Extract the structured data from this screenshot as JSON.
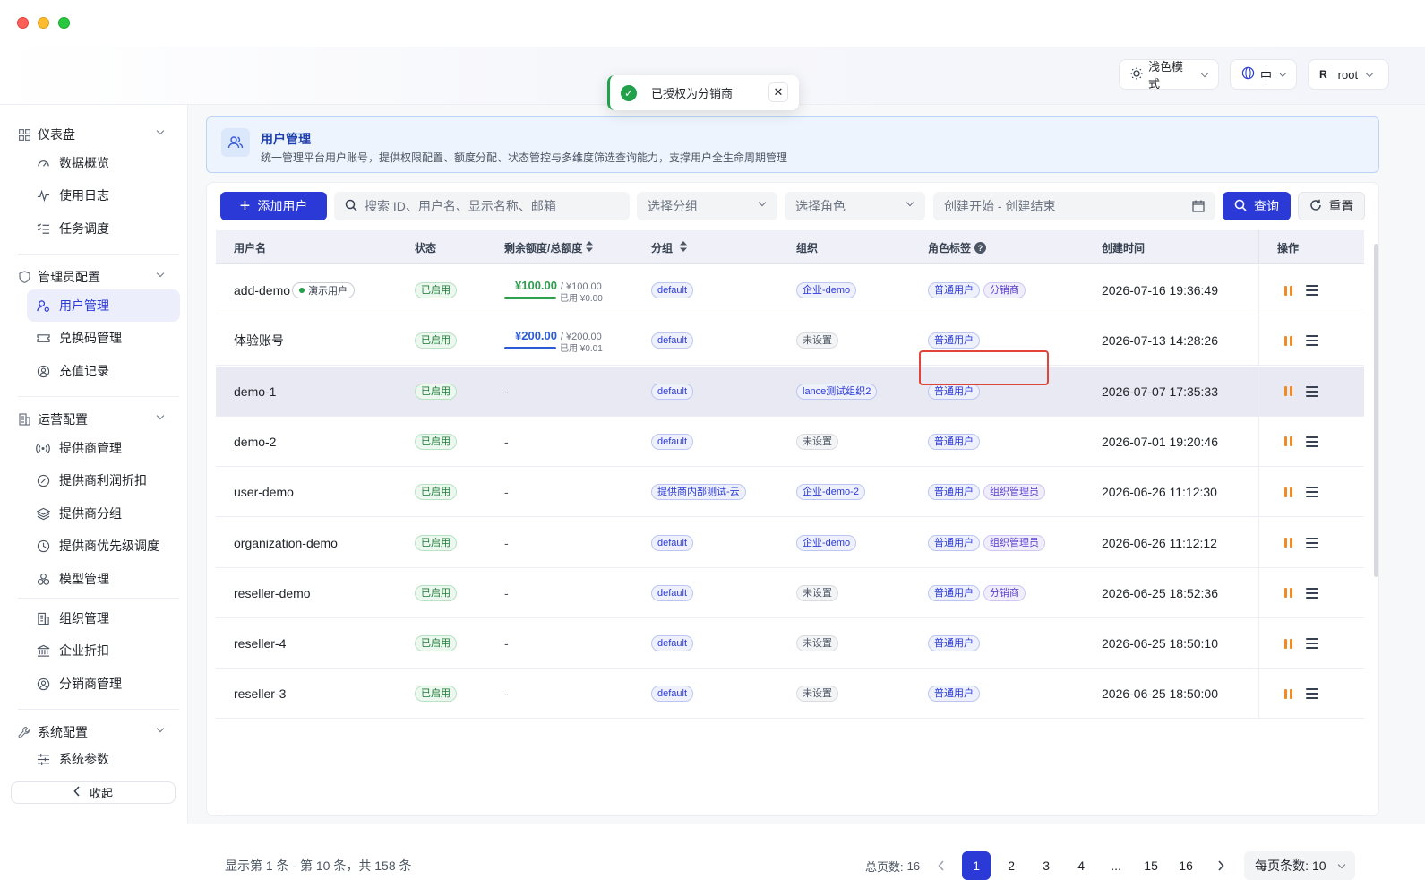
{
  "toast": {
    "text": "已授权为分销商"
  },
  "topbar": {
    "theme_label": "浅色模式",
    "lang_label": "中",
    "user_initial": "R",
    "user_name": "root"
  },
  "sidebar": {
    "sections": [
      {
        "label": "仪表盘",
        "items": [
          "数据概览",
          "使用日志",
          "任务调度"
        ]
      },
      {
        "label": "管理员配置",
        "items": [
          "用户管理",
          "兑换码管理",
          "充值记录"
        ]
      },
      {
        "label": "运营配置",
        "items": [
          "提供商管理",
          "提供商利润折扣",
          "提供商分组",
          "提供商优先级调度",
          "模型管理",
          "组织管理",
          "企业折扣",
          "分销商管理"
        ]
      },
      {
        "label": "系统配置",
        "items": [
          "系统参数"
        ]
      }
    ],
    "collapse_label": "收起"
  },
  "banner": {
    "title": "用户管理",
    "desc": "统一管理平台用户账号，提供权限配置、额度分配、状态管控与多维度筛选查询能力，支撑用户全生命周期管理"
  },
  "filters": {
    "add_label": "添加用户",
    "search_placeholder": "搜索 ID、用户名、显示名称、邮箱",
    "group_placeholder": "选择分组",
    "role_placeholder": "选择角色",
    "date_placeholder": "创建开始 - 创建结束",
    "query_label": "查询",
    "reset_label": "重置"
  },
  "table": {
    "columns": [
      "用户名",
      "状态",
      "剩余额度/总额度",
      "分组",
      "组织",
      "角色标签",
      "创建时间",
      "操作"
    ],
    "rows": [
      {
        "name": "add-demo",
        "badge": "演示用户",
        "status": "已启用",
        "quota": {
          "amount": "¥100.00",
          "total": "/ ¥100.00",
          "used": "已用 ¥0.00",
          "color": "#2e9e4f",
          "fill": 1.0
        },
        "group": "default",
        "org": "企业-demo",
        "org_set": true,
        "roles": [
          "普通用户",
          "分销商"
        ],
        "created": "2026-07-16 19:36:49"
      },
      {
        "name": "体验账号",
        "status": "已启用",
        "quota": {
          "amount": "¥200.00",
          "total": "/ ¥200.00",
          "used": "已用 ¥0.01",
          "color": "#2b5bd6",
          "fill": 1.0
        },
        "group": "default",
        "org": "未设置",
        "org_set": false,
        "roles": [
          "普通用户"
        ],
        "created": "2026-07-13 14:28:26"
      },
      {
        "name": "demo-1",
        "status": "已启用",
        "quota_text": "-",
        "group": "default",
        "org": "lance测试组织2",
        "org_set": true,
        "roles": [
          "普通用户"
        ],
        "created": "2026-07-07 17:35:33"
      },
      {
        "name": "demo-2",
        "status": "已启用",
        "quota_text": "-",
        "group": "default",
        "org": "未设置",
        "org_set": false,
        "roles": [
          "普通用户"
        ],
        "created": "2026-07-01 19:20:46"
      },
      {
        "name": "user-demo",
        "status": "已启用",
        "quota_text": "-",
        "group": "提供商内部测试-云",
        "org": "企业-demo-2",
        "org_set": true,
        "roles": [
          "普通用户",
          "组织管理员"
        ],
        "created": "2026-06-26 11:12:30"
      },
      {
        "name": "organization-demo",
        "status": "已启用",
        "quota_text": "-",
        "group": "default",
        "org": "企业-demo",
        "org_set": true,
        "roles": [
          "普通用户",
          "组织管理员"
        ],
        "created": "2026-06-26 11:12:12"
      },
      {
        "name": "reseller-demo",
        "status": "已启用",
        "quota_text": "-",
        "group": "default",
        "org": "未设置",
        "org_set": false,
        "roles": [
          "普通用户",
          "分销商"
        ],
        "created": "2026-06-25 18:52:36"
      },
      {
        "name": "reseller-4",
        "status": "已启用",
        "quota_text": "-",
        "group": "default",
        "org": "未设置",
        "org_set": false,
        "roles": [
          "普通用户"
        ],
        "created": "2026-06-25 18:50:10"
      },
      {
        "name": "reseller-3",
        "status": "已启用",
        "quota_text": "-",
        "group": "default",
        "org": "未设置",
        "org_set": false,
        "roles": [
          "普通用户"
        ],
        "created": "2026-06-25 18:50:00"
      }
    ]
  },
  "footer": {
    "summary": "显示第 1 条 - 第 10 条，共 158 条",
    "total_pages_label": "总页数:",
    "total_pages": "16",
    "pages": [
      "1",
      "2",
      "3",
      "4",
      "...",
      "15",
      "16"
    ],
    "current_page": "1",
    "page_size_label": "每页条数:",
    "page_size": "10"
  },
  "colors": {
    "accent": "#2b3ad6",
    "success": "#22a04a",
    "warning": "#f08a24",
    "highlight_box": "#e0453c"
  }
}
